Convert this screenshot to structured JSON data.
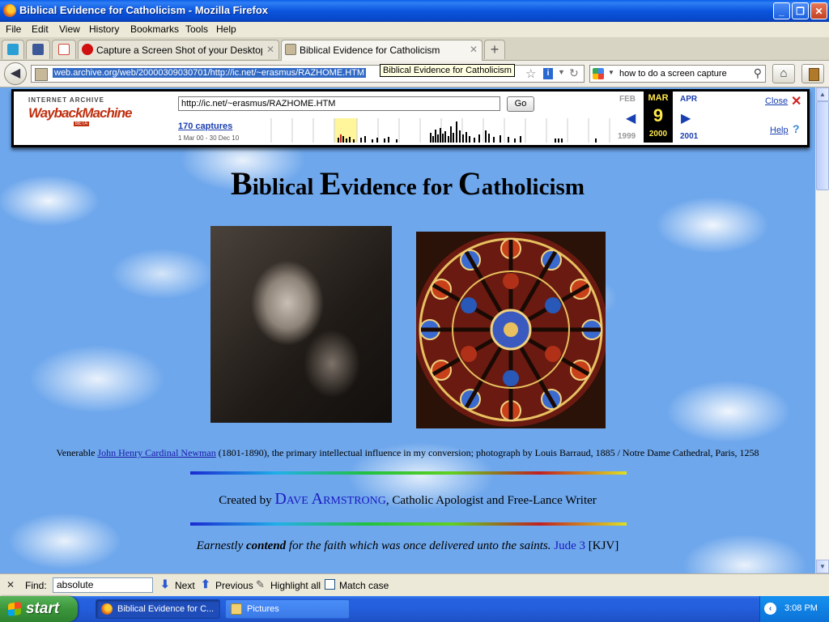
{
  "window": {
    "title": "Biblical Evidence for Catholicism - Mozilla Firefox",
    "controls": {
      "minimize": "_",
      "maximize": "❐",
      "close": "✕"
    }
  },
  "menu": [
    "File",
    "Edit",
    "View",
    "History",
    "Bookmarks",
    "Tools",
    "Help"
  ],
  "tabs": [
    {
      "label": "",
      "icon": "twitter-icon",
      "color": "#2a9fd6"
    },
    {
      "label": "",
      "icon": "facebook-icon",
      "color": "#3b5998"
    },
    {
      "label": "",
      "icon": "gmail-icon",
      "color": "#d44638"
    },
    {
      "label": "Capture a Screen Shot of your Desktop o...",
      "icon": "record-icon",
      "color": "#d01010"
    },
    {
      "label": "Biblical Evidence for Catholicism",
      "icon": "page-icon",
      "color": "#c8b89a",
      "active": true
    }
  ],
  "new_tab": "+",
  "navbar": {
    "url": "web.archive.org/web/20000309030701/http://ic.net/~erasmus/RAZHOME.HTM",
    "tooltip": "Biblical Evidence for Catholicism",
    "search_query": "how to do a screen capture"
  },
  "wayback": {
    "logo_top": "INTERNET ARCHIVE",
    "logo": "WaybackMachine",
    "beta": "BETA",
    "url_value": "http://ic.net/~erasmus/RAZHOME.HTM",
    "go": "Go",
    "captures": "170 captures",
    "range": "1 Mar 00 - 30 Dec 10",
    "prev_month": "FEB",
    "cur_month": "MAR",
    "cur_day": "9",
    "next_month": "APR",
    "prev_year": "1999",
    "cur_year": "2000",
    "next_year": "2001",
    "close": "Close",
    "help": "Help"
  },
  "page": {
    "title_parts": [
      {
        "cap": "B",
        "rest": "iblical "
      },
      {
        "cap": "E",
        "rest": "vidence for "
      },
      {
        "cap": "C",
        "rest": "atholicism"
      }
    ],
    "caption_pre": "Venerable ",
    "caption_link": "John Henry Cardinal Newman",
    "caption_post": " (1801-1890), the primary intellectual influence in my conversion; photograph by Louis Barraud, 1885 / Notre Dame Cathedral, Paris, 1258",
    "created_pre": "Created by ",
    "created_name": "Dave Armstrong",
    "created_post": ", Catholic Apologist and Free-Lance Writer",
    "quote_a": "Earnestly ",
    "quote_b": "contend",
    "quote_c": " for the faith which was once delivered unto the saints.",
    "quote_ref": "Jude 3",
    "quote_kjv": "[KJV]"
  },
  "findbar": {
    "close": "✕",
    "label": "Find:",
    "value": "absolute",
    "next": "Next",
    "previous": "Previous",
    "highlight": "Highlight all",
    "match_case": "Match case"
  },
  "taskbar": {
    "start": "start",
    "tasks": [
      {
        "label": "Biblical Evidence for C...",
        "active": true
      },
      {
        "label": "Pictures",
        "active": false
      }
    ],
    "clock": "3:08 PM"
  }
}
